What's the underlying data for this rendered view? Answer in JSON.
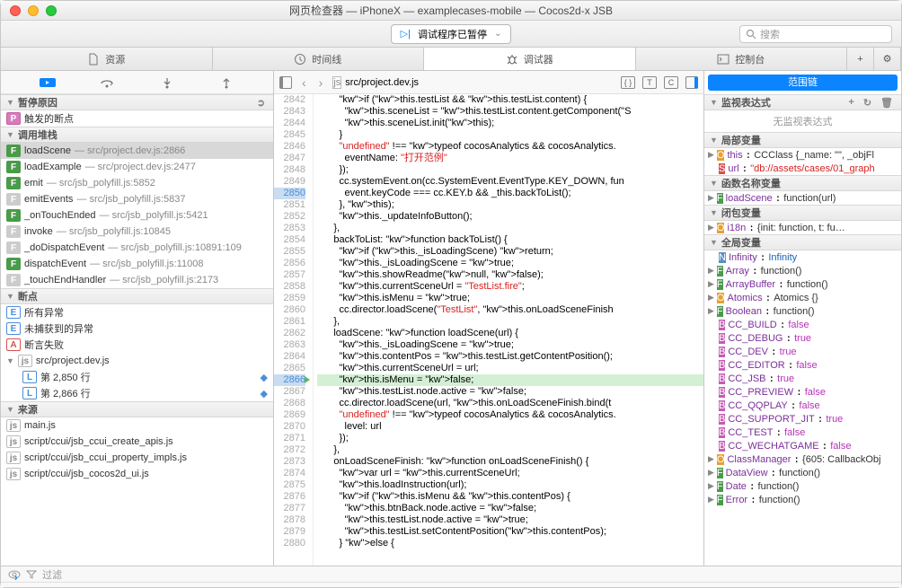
{
  "window": {
    "title": "网页检查器 — iPhoneX — examplecases-mobile — Cocos2d-x JSB"
  },
  "toolbar": {
    "status": "调试程序已暂停",
    "search_placeholder": "搜索"
  },
  "tabs": {
    "resources": "资源",
    "timeline": "时间线",
    "debugger": "调试器",
    "console": "控制台"
  },
  "pause": {
    "header": "暂停原因",
    "triggered": "触发的断点"
  },
  "callstack": {
    "header": "调用堆栈",
    "frames": [
      {
        "fn": "loadScene",
        "loc": "src/project.dev.js:2866",
        "kind": "f",
        "sel": true
      },
      {
        "fn": "loadExample",
        "loc": "src/project.dev.js:2477",
        "kind": "f"
      },
      {
        "fn": "emit",
        "loc": "src/jsb_polyfill.js:5852",
        "kind": "f"
      },
      {
        "fn": "emitEvents",
        "loc": "src/jsb_polyfill.js:5837",
        "kind": "fd"
      },
      {
        "fn": "_onTouchEnded",
        "loc": "src/jsb_polyfill.js:5421",
        "kind": "f"
      },
      {
        "fn": "invoke",
        "loc": "src/jsb_polyfill.js:10845",
        "kind": "fd"
      },
      {
        "fn": "_doDispatchEvent",
        "loc": "src/jsb_polyfill.js:10891:109",
        "kind": "fd"
      },
      {
        "fn": "dispatchEvent",
        "loc": "src/jsb_polyfill.js:11008",
        "kind": "f"
      },
      {
        "fn": "_touchEndHandler",
        "loc": "src/jsb_polyfill.js:2173",
        "kind": "fd"
      }
    ]
  },
  "breakpoints": {
    "header": "断点",
    "all_ex": "所有异常",
    "uncaught_ex": "未捕获到的异常",
    "assert_fail": "断言失败",
    "file": "src/project.dev.js",
    "bp1": "第 2,850 行",
    "bp2": "第 2,866 行"
  },
  "sources": {
    "header": "来源",
    "items": [
      "main.js",
      "script/ccui/jsb_ccui_create_apis.js",
      "script/ccui/jsb_ccui_property_impls.js",
      "script/ccui/jsb_cocos2d_ui.js"
    ]
  },
  "filter": {
    "label": "过滤"
  },
  "editor": {
    "file": "src/project.dev.js"
  },
  "code": {
    "start": 2842,
    "bp_lines": [
      2850,
      2866
    ],
    "exec_line": 2866,
    "lines": [
      "        if (this.testList && this.testList.content) {",
      "          this.sceneList = this.testList.content.getComponent(\"S",
      "          this.sceneList.init(this);",
      "        }",
      "        \"undefined\" !== typeof cocosAnalytics && cocosAnalytics.",
      "          eventName: \"打开范例\"",
      "        });",
      "        cc.systemEvent.on(cc.SystemEvent.EventType.KEY_DOWN, fun",
      "          event.keyCode === cc.KEY.b && _this.backToList();",
      "        }, this);",
      "        this._updateInfoButton();",
      "      },",
      "      backToList: function backToList() {",
      "        if (this._isLoadingScene) return;",
      "        this._isLoadingScene = true;",
      "        this.showReadme(null, false);",
      "        this.currentSceneUrl = \"TestList.fire\";",
      "        this.isMenu = true;",
      "        cc.director.loadScene(\"TestList\", this.onLoadSceneFinish",
      "      },",
      "      loadScene: function loadScene(url) {",
      "        this._isLoadingScene = true;",
      "        this.contentPos = this.testList.getContentPosition();",
      "        this.currentSceneUrl = url;",
      "        this.isMenu = false;",
      "        this.testList.node.active = false;",
      "        cc.director.loadScene(url, this.onLoadSceneFinish.bind(t",
      "        \"undefined\" !== typeof cocosAnalytics && cocosAnalytics.",
      "          level: url",
      "        });",
      "      },",
      "      onLoadSceneFinish: function onLoadSceneFinish() {",
      "        var url = this.currentSceneUrl;",
      "        this.loadInstruction(url);",
      "        if (this.isMenu && this.contentPos) {",
      "          this.btnBack.node.active = false;",
      "          this.testList.node.active = true;",
      "          this.testList.setContentPosition(this.contentPos);",
      "        } else {"
    ]
  },
  "scope": {
    "btn": "范围链",
    "watch": {
      "header": "监视表达式",
      "empty": "无监视表达式"
    },
    "local": {
      "header": "局部变量",
      "this": "this",
      "this_t": "CCClass",
      "this_v": "{_name: \"\", _objFl",
      "url": "url",
      "url_v": "\"db://assets/cases/01_graph"
    },
    "funcname": {
      "header": "函数名称变量",
      "name": "loadScene",
      "val": "function(url)"
    },
    "closure": {
      "header": "闭包变量",
      "name": "i18n",
      "val": "{init: function, t: fu…"
    },
    "global": {
      "header": "全局变量",
      "items": [
        {
          "k": "Infinity",
          "t": "n",
          "v": "Infinity",
          "vt": "num"
        },
        {
          "k": "Array",
          "t": "f",
          "v": "function()"
        },
        {
          "k": "ArrayBuffer",
          "t": "f",
          "v": "function()"
        },
        {
          "k": "Atomics",
          "t": "o",
          "v": "Atomics {}"
        },
        {
          "k": "Boolean",
          "t": "f",
          "v": "function()"
        },
        {
          "k": "CC_BUILD",
          "t": "b",
          "v": "false",
          "vt": "bool"
        },
        {
          "k": "CC_DEBUG",
          "t": "b",
          "v": "true",
          "vt": "bool"
        },
        {
          "k": "CC_DEV",
          "t": "b",
          "v": "true",
          "vt": "bool"
        },
        {
          "k": "CC_EDITOR",
          "t": "b",
          "v": "false",
          "vt": "bool"
        },
        {
          "k": "CC_JSB",
          "t": "b",
          "v": "true",
          "vt": "bool"
        },
        {
          "k": "CC_PREVIEW",
          "t": "b",
          "v": "false",
          "vt": "bool"
        },
        {
          "k": "CC_QQPLAY",
          "t": "b",
          "v": "false",
          "vt": "bool"
        },
        {
          "k": "CC_SUPPORT_JIT",
          "t": "b",
          "v": "true",
          "vt": "bool"
        },
        {
          "k": "CC_TEST",
          "t": "b",
          "v": "false",
          "vt": "bool"
        },
        {
          "k": "CC_WECHATGAME",
          "t": "b",
          "v": "false",
          "vt": "bool"
        },
        {
          "k": "ClassManager",
          "t": "o",
          "v": "{605: CallbackObj"
        },
        {
          "k": "DataView",
          "t": "f",
          "v": "function()"
        },
        {
          "k": "Date",
          "t": "f",
          "v": "function()"
        },
        {
          "k": "Error",
          "t": "f",
          "v": "function()"
        }
      ]
    }
  }
}
